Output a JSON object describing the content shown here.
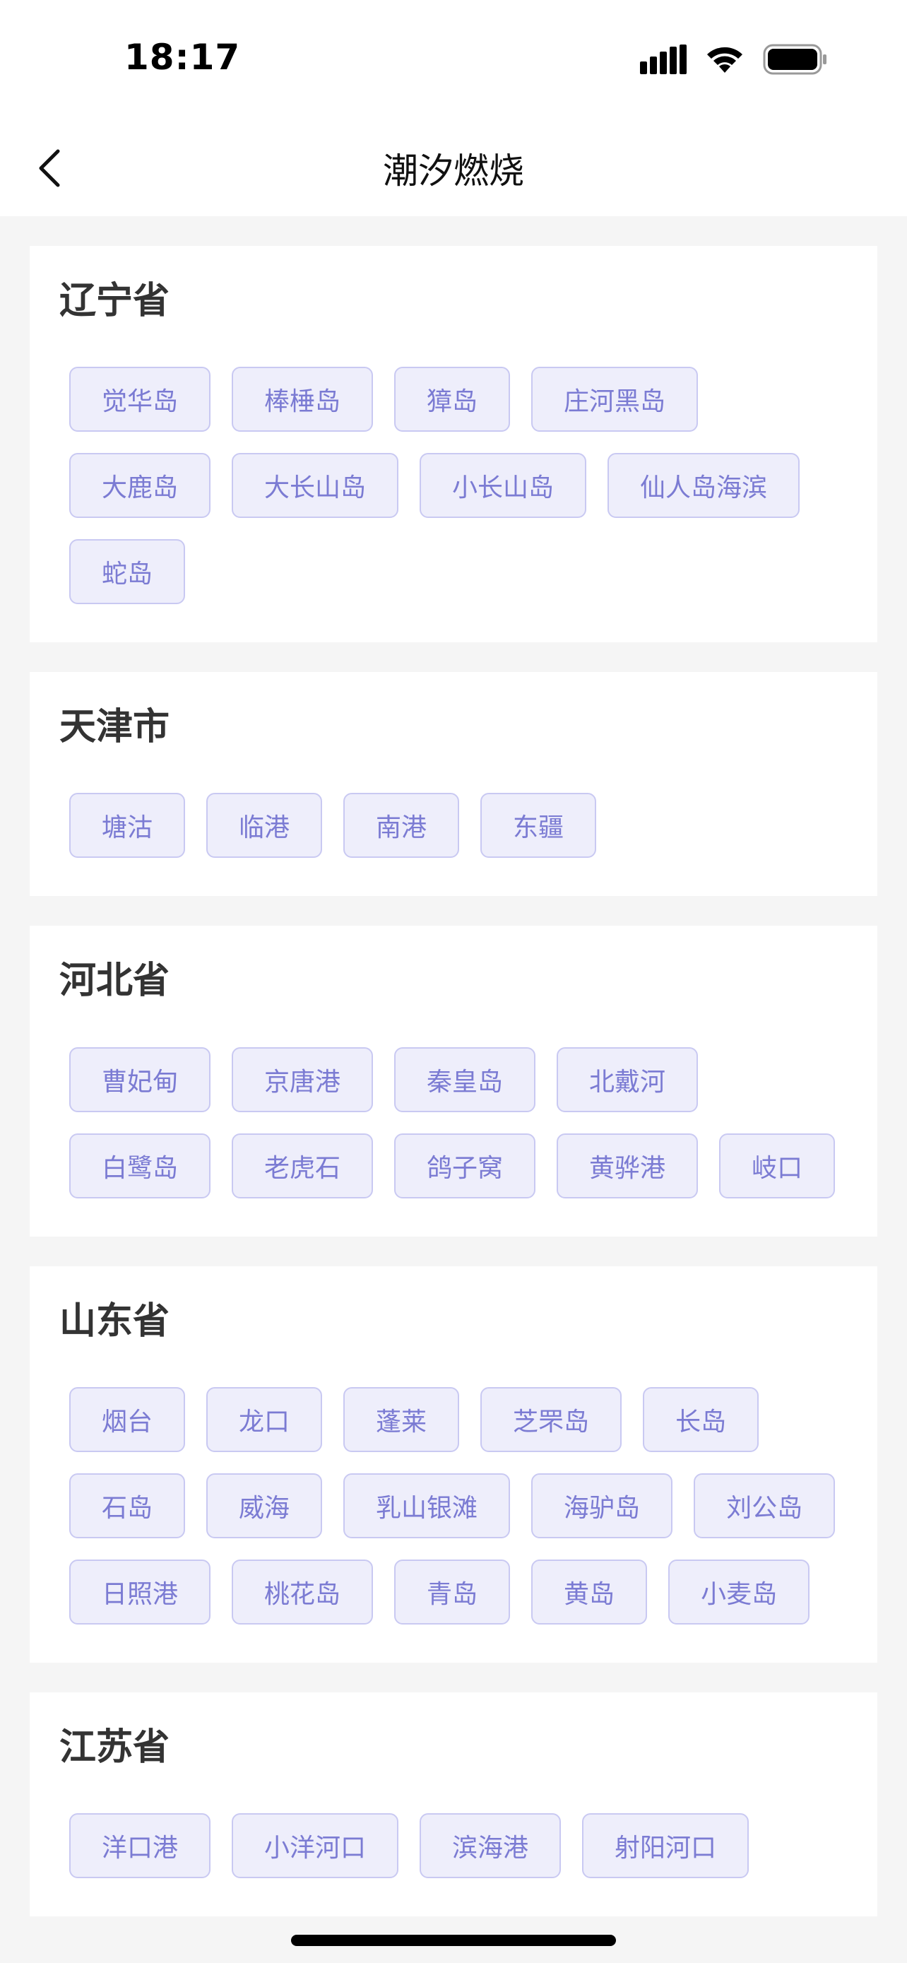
{
  "status_bar": {
    "time": "18:17"
  },
  "nav": {
    "title": "潮汐燃烧"
  },
  "sections": [
    {
      "title": "辽宁省",
      "items": [
        "觉华岛",
        "棒棰岛",
        "獐岛",
        "庄河黑岛",
        "大鹿岛",
        "大长山岛",
        "小长山岛",
        "仙人岛海滨",
        "蛇岛"
      ]
    },
    {
      "title": "天津市",
      "items": [
        "塘沽",
        "临港",
        "南港",
        "东疆"
      ]
    },
    {
      "title": "河北省",
      "items": [
        "曹妃甸",
        "京唐港",
        "秦皇岛",
        "北戴河",
        "白鹭岛",
        "老虎石",
        "鸽子窝",
        "黄骅港",
        "岐口"
      ]
    },
    {
      "title": "山东省",
      "items": [
        "烟台",
        "龙口",
        "蓬莱",
        "芝罘岛",
        "长岛",
        "石岛",
        "威海",
        "乳山银滩",
        "海驴岛",
        "刘公岛",
        "日照港",
        "桃花岛",
        "青岛",
        "黄岛",
        "小麦岛"
      ]
    },
    {
      "title": "江苏省",
      "items": [
        "洋口港",
        "小洋河口",
        "滨海港",
        "射阳河口"
      ]
    }
  ],
  "colors": {
    "tag_bg": "#eeeefb",
    "tag_border": "#c9c9f2",
    "tag_text": "#7b7bd3",
    "page_bg": "#f5f5f5"
  }
}
